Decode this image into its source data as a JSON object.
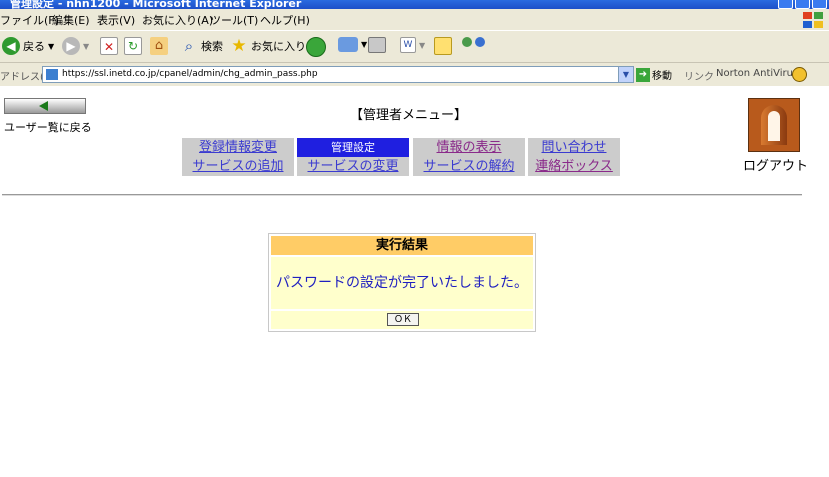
{
  "window": {
    "title": "管理設定 - nhn1200 - Microsoft Internet Explorer"
  },
  "menu": [
    "ファイル(F)",
    "編集(E)",
    "表示(V)",
    "お気に入り(A)",
    "ツール(T)",
    "ヘルプ(H)"
  ],
  "toolbar": {
    "back_label": "戻る",
    "search_label": "検索",
    "favorites_label": "お気に入り"
  },
  "address": {
    "label": "アドレス(D)",
    "url": "https://ssl.inetd.co.jp/cpanel/admin/chg_admin_pass.php",
    "go_label": "移動",
    "links_label": "リンク",
    "norton_label": "Norton AntiVirus"
  },
  "page": {
    "back_to_list": "ユーザー覧に戻る",
    "menu_title": "【管理者メニュー】",
    "logout": "ログアウト",
    "nav": [
      [
        "登録情報変更",
        "管理設定",
        "情報の表示",
        "問い合わせ"
      ],
      [
        "サービスの追加",
        "サービスの変更",
        "サービスの解約",
        "連絡ボックス"
      ]
    ],
    "result": {
      "title": "実行結果",
      "message": "パスワードの設定が完了いたしました。",
      "ok": "ＯＫ"
    }
  },
  "colors": {
    "nav_bg": "#cccccc",
    "nav_active_bg": "#1f1fe0",
    "link": "#3b3bd0",
    "visited_link": "#8a2a8a",
    "result_header_bg": "#ffcc66",
    "result_body_bg": "#ffffcc",
    "result_text": "#2020c0"
  }
}
